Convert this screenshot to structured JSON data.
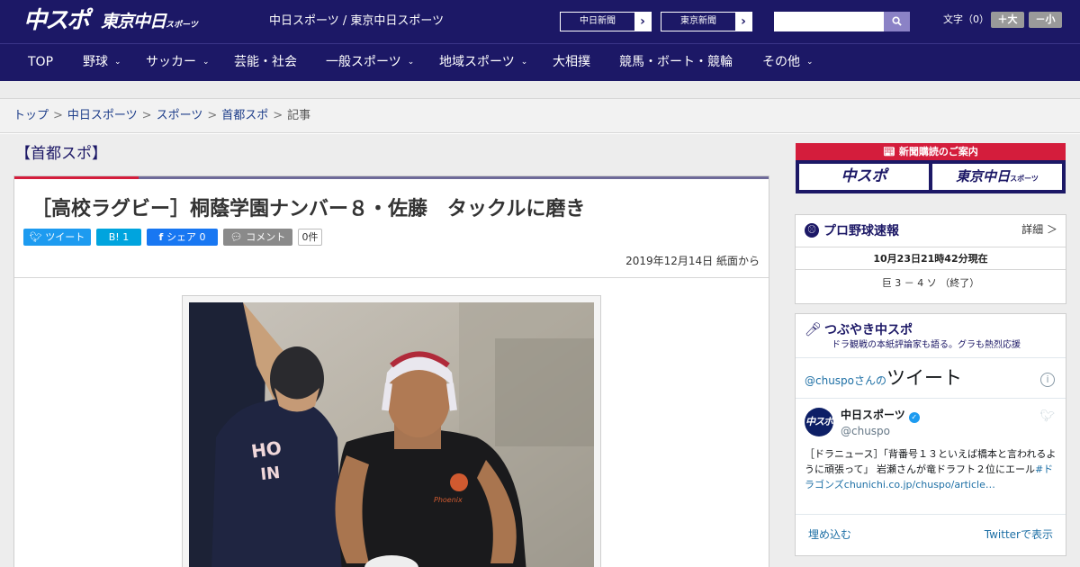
{
  "header": {
    "logo_chupo": "中スポ",
    "logo_tokyo": "東京中日",
    "logo_tokyo_small": "スポーツ",
    "site_title": "中日スポーツ / 東京中日スポーツ",
    "ext_links": [
      {
        "label": "中日新聞",
        "arrow": "›"
      },
      {
        "label": "東京新聞",
        "arrow": "›"
      }
    ],
    "search": {
      "value": "",
      "icon": "search-icon"
    },
    "font_size": {
      "label": "文字（0）",
      "bigger": "＋大",
      "smaller": "－小"
    }
  },
  "nav": {
    "items": [
      {
        "label": "TOP",
        "has_dropdown": false
      },
      {
        "label": "野球",
        "has_dropdown": true
      },
      {
        "label": "サッカー",
        "has_dropdown": true
      },
      {
        "label": "芸能・社会",
        "has_dropdown": false
      },
      {
        "label": "一般スポーツ",
        "has_dropdown": true
      },
      {
        "label": "地域スポーツ",
        "has_dropdown": true
      },
      {
        "label": "大相撲",
        "has_dropdown": false
      },
      {
        "label": "競馬・ボート・競輪",
        "has_dropdown": false
      },
      {
        "label": "その他",
        "has_dropdown": true
      }
    ],
    "chevron": "⌄"
  },
  "breadcrumb": {
    "items": [
      "トップ",
      "中日スポーツ",
      "スポーツ",
      "首都スポ"
    ],
    "current": "記事",
    "separator": ">"
  },
  "article": {
    "section": "【首都スポ】",
    "headline": "［高校ラグビー］桐蔭学園ナンバー８・佐藤　タックルに磨き",
    "share": {
      "tweet": "ツイート",
      "hatena": "B! 1",
      "facebook": "シェア 0",
      "comment": "コメント",
      "count": "0件"
    },
    "dateline": "2019年12月14日 紙面から"
  },
  "sidebar": {
    "subscribe": {
      "title": "新聞購読のご案内",
      "logo1": "中スポ",
      "logo2": "東京中日",
      "logo2_small": "スポーツ"
    },
    "baseball": {
      "title": "プロ野球速報",
      "more": "詳細 ＞",
      "time": "10月23日21時42分現在",
      "score": "巨 3 － 4 ソ （終了）"
    },
    "tweets": {
      "title": "つぶやき中スポ",
      "subtitle": "ドラ観戦の本紙評論家も語る。グラも熱烈応援",
      "embed": {
        "handle_prefix": "@chuspoさんの",
        "tweet_label": "ツイート",
        "account_name": "中日スポーツ",
        "account_handle": "@chuspo",
        "avatar_text": "中スポ",
        "tweet_text": "［ドラニュース］「背番号１３といえば橋本と言われるように頑張って」 岩瀬さんが竜ドラフト２位にエール",
        "tweet_hashtag": "#ドラゴンズ",
        "tweet_link": "chunichi.co.jp/chuspo/article…",
        "embed_link": "埋め込む",
        "view_link": "Twitterで表示"
      }
    }
  },
  "colors": {
    "brand_navy": "#1c1866",
    "accent_red": "#d41d3c",
    "twitter_blue": "#1d9bf0",
    "facebook_blue": "#1877f2",
    "hatena_blue": "#00a4de"
  }
}
